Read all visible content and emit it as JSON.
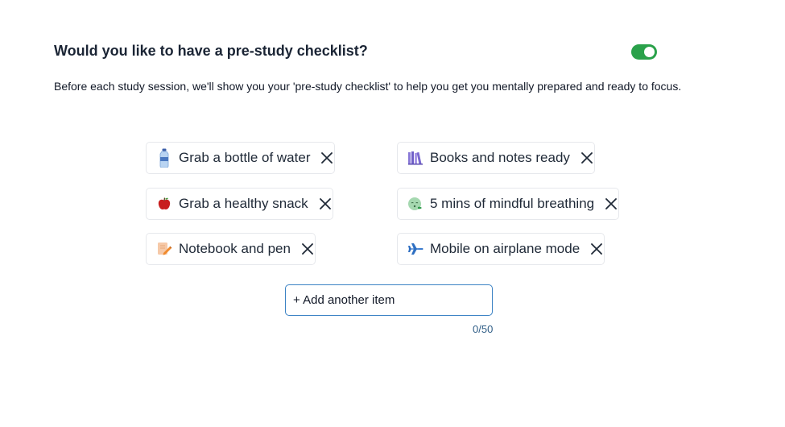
{
  "header": {
    "title": "Would you like to have a pre-study checklist?",
    "toggle_on": true,
    "toggle_color": "#2aa14a"
  },
  "description": "Before each study session, we'll show you your 'pre-study checklist' to help you get you mentally prepared and ready to focus.",
  "checklist": {
    "items": [
      {
        "icon": "water-bottle-icon",
        "label": "Grab a bottle of water"
      },
      {
        "icon": "books-icon",
        "label": "Books and notes ready"
      },
      {
        "icon": "apple-icon",
        "label": "Grab a healthy snack"
      },
      {
        "icon": "breathing-face-icon",
        "label": "5 mins of mindful breathing"
      },
      {
        "icon": "notebook-pen-icon",
        "label": "Notebook and pen"
      },
      {
        "icon": "airplane-icon",
        "label": "Mobile on airplane mode"
      }
    ]
  },
  "add_item": {
    "placeholder": "+ Add another item",
    "value": "",
    "counter": "0/50"
  }
}
